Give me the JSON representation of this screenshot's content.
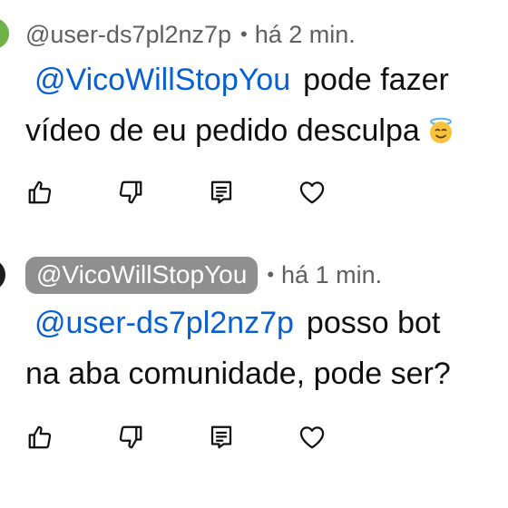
{
  "comments": [
    {
      "author": "@user-ds7pl2nz7p",
      "separator": "•",
      "time": "há 2 min.",
      "mention": "@VicoWillStopYou",
      "line1": "pode fazer",
      "line2": "vídeo de eu pedido desculpa",
      "emoji": "smiling-face-with-halo"
    },
    {
      "author": "@VicoWillStopYou",
      "separator": "•",
      "time": "há 1 min.",
      "mention": "@user-ds7pl2nz7p",
      "line1": "posso bot",
      "line2": "na aba comunidade, pode ser?"
    }
  ],
  "colors": {
    "mention": "#065fd4",
    "meta": "#5f5f5f",
    "author_chip_bg": "#8f8f8f",
    "text": "#0f0f0f"
  },
  "icons": [
    "like-icon",
    "dislike-icon",
    "reply-icon",
    "heart-icon"
  ]
}
